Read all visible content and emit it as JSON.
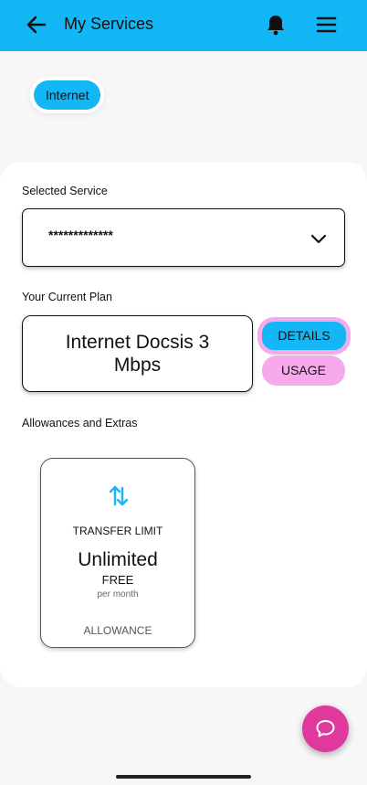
{
  "header": {
    "title": "My Services"
  },
  "service_tab": {
    "label": "Internet"
  },
  "selected_service": {
    "label": "Selected Service",
    "value": "*************"
  },
  "current_plan": {
    "label": "Your Current Plan",
    "name": "Internet Docsis 3 Mbps",
    "details_label": "DETAILS",
    "usage_label": "USAGE"
  },
  "allowances": {
    "label": "Allowances and Extras",
    "items": [
      {
        "icon": "transfer-arrows-icon",
        "type": "TRANSFER LIMIT",
        "value": "Unlimited",
        "price": "FREE",
        "period": "per month",
        "category": "ALLOWANCE"
      }
    ]
  },
  "colors": {
    "header": "#14b7f5",
    "accent_blue": "#14b7f5",
    "accent_pink": "#f6a9ec",
    "chat_button": "#e0399d"
  }
}
